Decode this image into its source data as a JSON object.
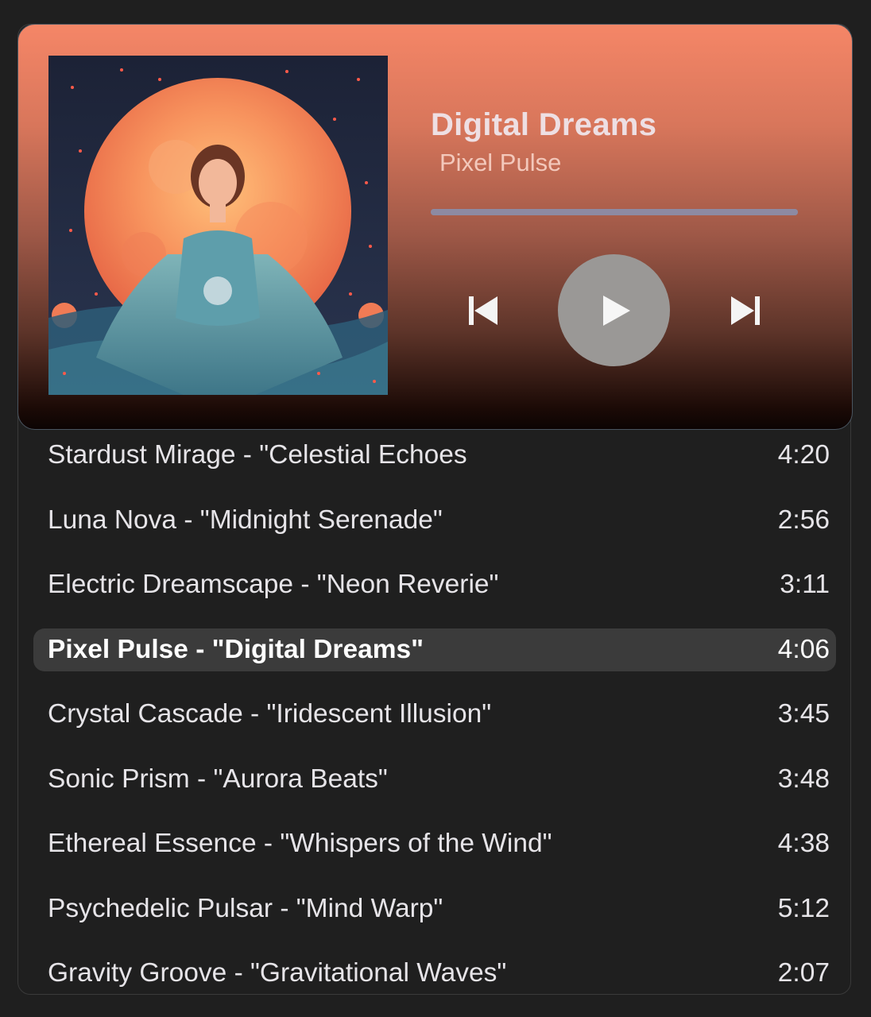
{
  "colors": {
    "background": "#1f1f1f",
    "player_gradient_top": "#f58667",
    "player_gradient_bottom": "#0c0403",
    "active_row": "#3b3b3b",
    "progress_bar": "#8d8aa2",
    "play_button": "#9a9896"
  },
  "now_playing": {
    "title": "Digital Dreams",
    "artist": "Pixel Pulse",
    "progress_fraction": 1.0
  },
  "controls": {
    "previous_icon": "skip-previous-icon",
    "play_icon": "play-icon",
    "next_icon": "skip-next-icon"
  },
  "tracklist": [
    {
      "name": "Stardust Mirage - \"Celestial Echoes",
      "duration": "4:20",
      "active": false
    },
    {
      "name": "Luna Nova - \"Midnight Serenade\"",
      "duration": "2:56",
      "active": false
    },
    {
      "name": "Electric Dreamscape - \"Neon Reverie\"",
      "duration": "3:11",
      "active": false
    },
    {
      "name": "Pixel Pulse - \"Digital Dreams\"",
      "duration": "4:06",
      "active": true
    },
    {
      "name": "Crystal Cascade - \"Iridescent Illusion\"",
      "duration": "3:45",
      "active": false
    },
    {
      "name": "Sonic Prism - \"Aurora Beats\"",
      "duration": "3:48",
      "active": false
    },
    {
      "name": "Ethereal Essence - \"Whispers of the Wind\"",
      "duration": "4:38",
      "active": false
    },
    {
      "name": "Psychedelic Pulsar - \"Mind Warp\"",
      "duration": "5:12",
      "active": false
    },
    {
      "name": "Gravity Groove - \"Gravitational Waves\"",
      "duration": "2:07",
      "active": false
    }
  ]
}
